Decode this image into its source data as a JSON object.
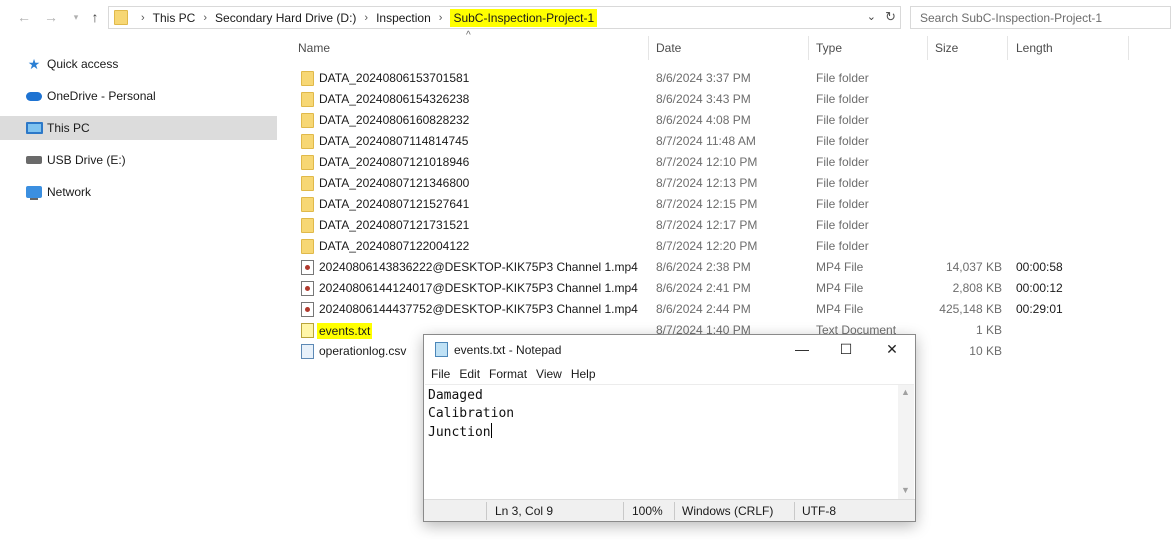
{
  "address_bar": {
    "crumbs": [
      "This PC",
      "Secondary Hard Drive (D:)",
      "Inspection",
      "SubC-Inspection-Project-1"
    ],
    "current": "SubC-Inspection-Project-1"
  },
  "search": {
    "placeholder": "Search SubC-Inspection-Project-1"
  },
  "sidebar": {
    "items": [
      {
        "label": "Quick access",
        "icon": "star-icon"
      },
      {
        "label": "OneDrive - Personal",
        "icon": "cloud-icon"
      },
      {
        "label": "This PC",
        "icon": "computer-icon",
        "selected": true
      },
      {
        "label": "USB Drive (E:)",
        "icon": "usb-drive-icon"
      },
      {
        "label": "Network",
        "icon": "network-icon"
      }
    ]
  },
  "columns": {
    "name": "Name",
    "date": "Date",
    "type": "Type",
    "size": "Size",
    "length": "Length"
  },
  "files": [
    {
      "name": "DATA_20240806153701581",
      "date": "8/6/2024 3:37 PM",
      "type": "File folder",
      "size": "",
      "length": "",
      "icon": "folder-icon"
    },
    {
      "name": "DATA_20240806154326238",
      "date": "8/6/2024 3:43 PM",
      "type": "File folder",
      "size": "",
      "length": "",
      "icon": "folder-icon"
    },
    {
      "name": "DATA_20240806160828232",
      "date": "8/6/2024 4:08 PM",
      "type": "File folder",
      "size": "",
      "length": "",
      "icon": "folder-icon"
    },
    {
      "name": "DATA_20240807114814745",
      "date": "8/7/2024 11:48 AM",
      "type": "File folder",
      "size": "",
      "length": "",
      "icon": "folder-icon"
    },
    {
      "name": "DATA_20240807121018946",
      "date": "8/7/2024 12:10 PM",
      "type": "File folder",
      "size": "",
      "length": "",
      "icon": "folder-icon"
    },
    {
      "name": "DATA_20240807121346800",
      "date": "8/7/2024 12:13 PM",
      "type": "File folder",
      "size": "",
      "length": "",
      "icon": "folder-icon"
    },
    {
      "name": "DATA_20240807121527641",
      "date": "8/7/2024 12:15 PM",
      "type": "File folder",
      "size": "",
      "length": "",
      "icon": "folder-icon"
    },
    {
      "name": "DATA_20240807121731521",
      "date": "8/7/2024 12:17 PM",
      "type": "File folder",
      "size": "",
      "length": "",
      "icon": "folder-icon"
    },
    {
      "name": "DATA_20240807122004122",
      "date": "8/7/2024 12:20 PM",
      "type": "File folder",
      "size": "",
      "length": "",
      "icon": "folder-icon"
    },
    {
      "name": "20240806143836222@DESKTOP-KIK75P3 Channel 1.mp4",
      "date": "8/6/2024 2:38 PM",
      "type": "MP4 File",
      "size": "14,037 KB",
      "length": "00:00:58",
      "icon": "video-file-icon"
    },
    {
      "name": "20240806144124017@DESKTOP-KIK75P3 Channel 1.mp4",
      "date": "8/6/2024 2:41 PM",
      "type": "MP4 File",
      "size": "2,808 KB",
      "length": "00:00:12",
      "icon": "video-file-icon"
    },
    {
      "name": "20240806144437752@DESKTOP-KIK75P3 Channel 1.mp4",
      "date": "8/6/2024 2:44 PM",
      "type": "MP4 File",
      "size": "425,148 KB",
      "length": "00:29:01",
      "icon": "video-file-icon"
    },
    {
      "name": "events.txt",
      "date": "8/7/2024 1:40 PM",
      "type": "Text Document",
      "size": "1 KB",
      "length": "",
      "icon": "text-file-icon",
      "highlighted": true
    },
    {
      "name": "operationlog.csv",
      "date": "",
      "type": "",
      "size": "10 KB",
      "length": "",
      "icon": "csv-file-icon"
    }
  ],
  "notepad": {
    "title": "events.txt - Notepad",
    "menu": [
      "File",
      "Edit",
      "Format",
      "View",
      "Help"
    ],
    "text": "Damaged\nCalibration\nJunction",
    "status": {
      "position": "Ln 3, Col 9",
      "zoom": "100%",
      "line_ending": "Windows (CRLF)",
      "encoding": "UTF-8"
    },
    "window_buttons": {
      "minimize": "—",
      "maximize": "☐",
      "close": "✕"
    }
  },
  "colors": {
    "highlight": "#ffff00",
    "selected_bg": "#dcdcdc",
    "folder": "#f7d774"
  }
}
